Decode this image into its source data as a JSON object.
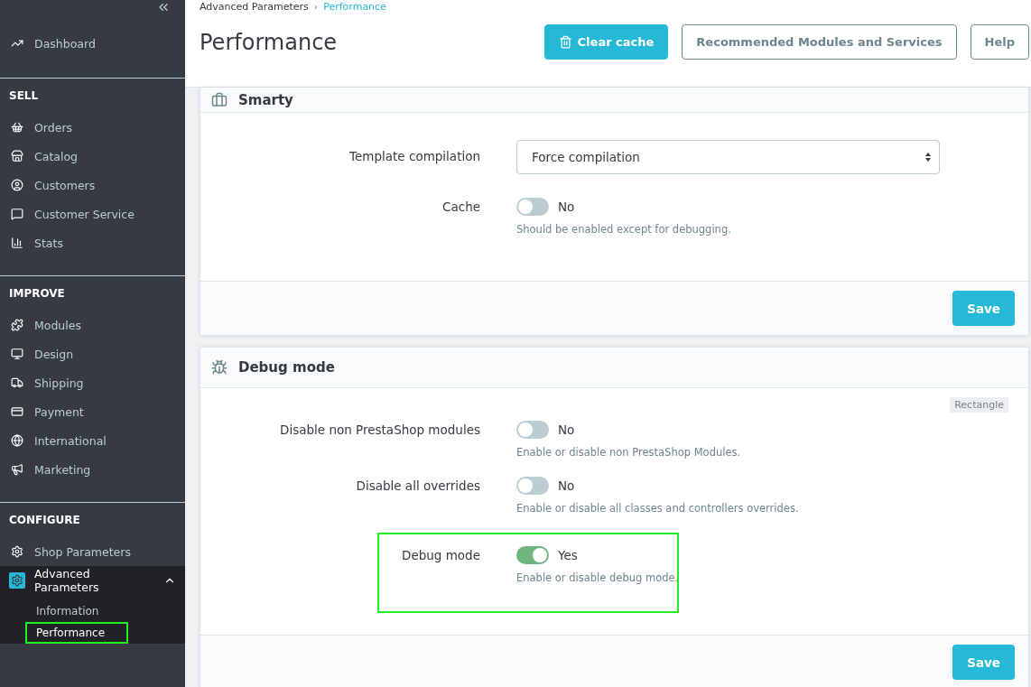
{
  "sidebar": {
    "sections": [
      {
        "items": [
          {
            "label": "Dashboard",
            "selected": false
          }
        ]
      },
      {
        "heading": "SELL",
        "items": [
          {
            "label": "Orders",
            "selected": false
          },
          {
            "label": "Catalog",
            "selected": false
          },
          {
            "label": "Customers",
            "selected": false
          },
          {
            "label": "Customer Service",
            "selected": false
          },
          {
            "label": "Stats",
            "selected": false
          }
        ]
      },
      {
        "heading": "IMPROVE",
        "items": [
          {
            "label": "Modules",
            "selected": false
          },
          {
            "label": "Design",
            "selected": false
          },
          {
            "label": "Shipping",
            "selected": false
          },
          {
            "label": "Payment",
            "selected": false
          },
          {
            "label": "International",
            "selected": false
          },
          {
            "label": "Marketing",
            "selected": false
          }
        ]
      },
      {
        "heading": "CONFIGURE",
        "items": [
          {
            "label": "Shop Parameters",
            "selected": false
          },
          {
            "label": "Advanced Parameters",
            "selected": true,
            "expanded": true,
            "children": [
              {
                "label": "Information",
                "selected": false,
                "highlighted": false
              },
              {
                "label": "Performance",
                "selected": true,
                "highlighted": true
              }
            ]
          }
        ]
      }
    ]
  },
  "header": {
    "breadcrumb": [
      "Advanced Parameters",
      "Performance"
    ],
    "separator": "›",
    "title": "Performance",
    "buttons": [
      {
        "label": "Clear cache",
        "kind": "primary"
      },
      {
        "label": "Recommended Modules and Services",
        "kind": "outline"
      },
      {
        "label": "Help",
        "kind": "outline"
      }
    ]
  },
  "panels": [
    {
      "title": "Smarty",
      "fields": [
        {
          "kind": "select",
          "label": "Template compilation",
          "value": "Force compilation",
          "highlighted": false
        },
        {
          "kind": "switch",
          "label": "Cache",
          "on": false,
          "state_label": "No",
          "help": "Should be enabled except for debugging.",
          "highlighted": false
        }
      ],
      "save": "Save"
    },
    {
      "title": "Debug mode",
      "tag": "Rectangle",
      "fields": [
        {
          "kind": "switch",
          "label": "Disable non PrestaShop modules",
          "on": false,
          "state_label": "No",
          "help": "Enable or disable non PrestaShop Modules.",
          "highlighted": false
        },
        {
          "kind": "switch",
          "label": "Disable all overrides",
          "on": false,
          "state_label": "No",
          "help": "Enable or disable all classes and controllers overrides.",
          "highlighted": false
        },
        {
          "kind": "switch",
          "label": "Debug mode",
          "on": true,
          "state_label": "Yes",
          "help": "Enable or disable debug mode.",
          "highlighted": true
        }
      ],
      "save": "Save"
    }
  ]
}
